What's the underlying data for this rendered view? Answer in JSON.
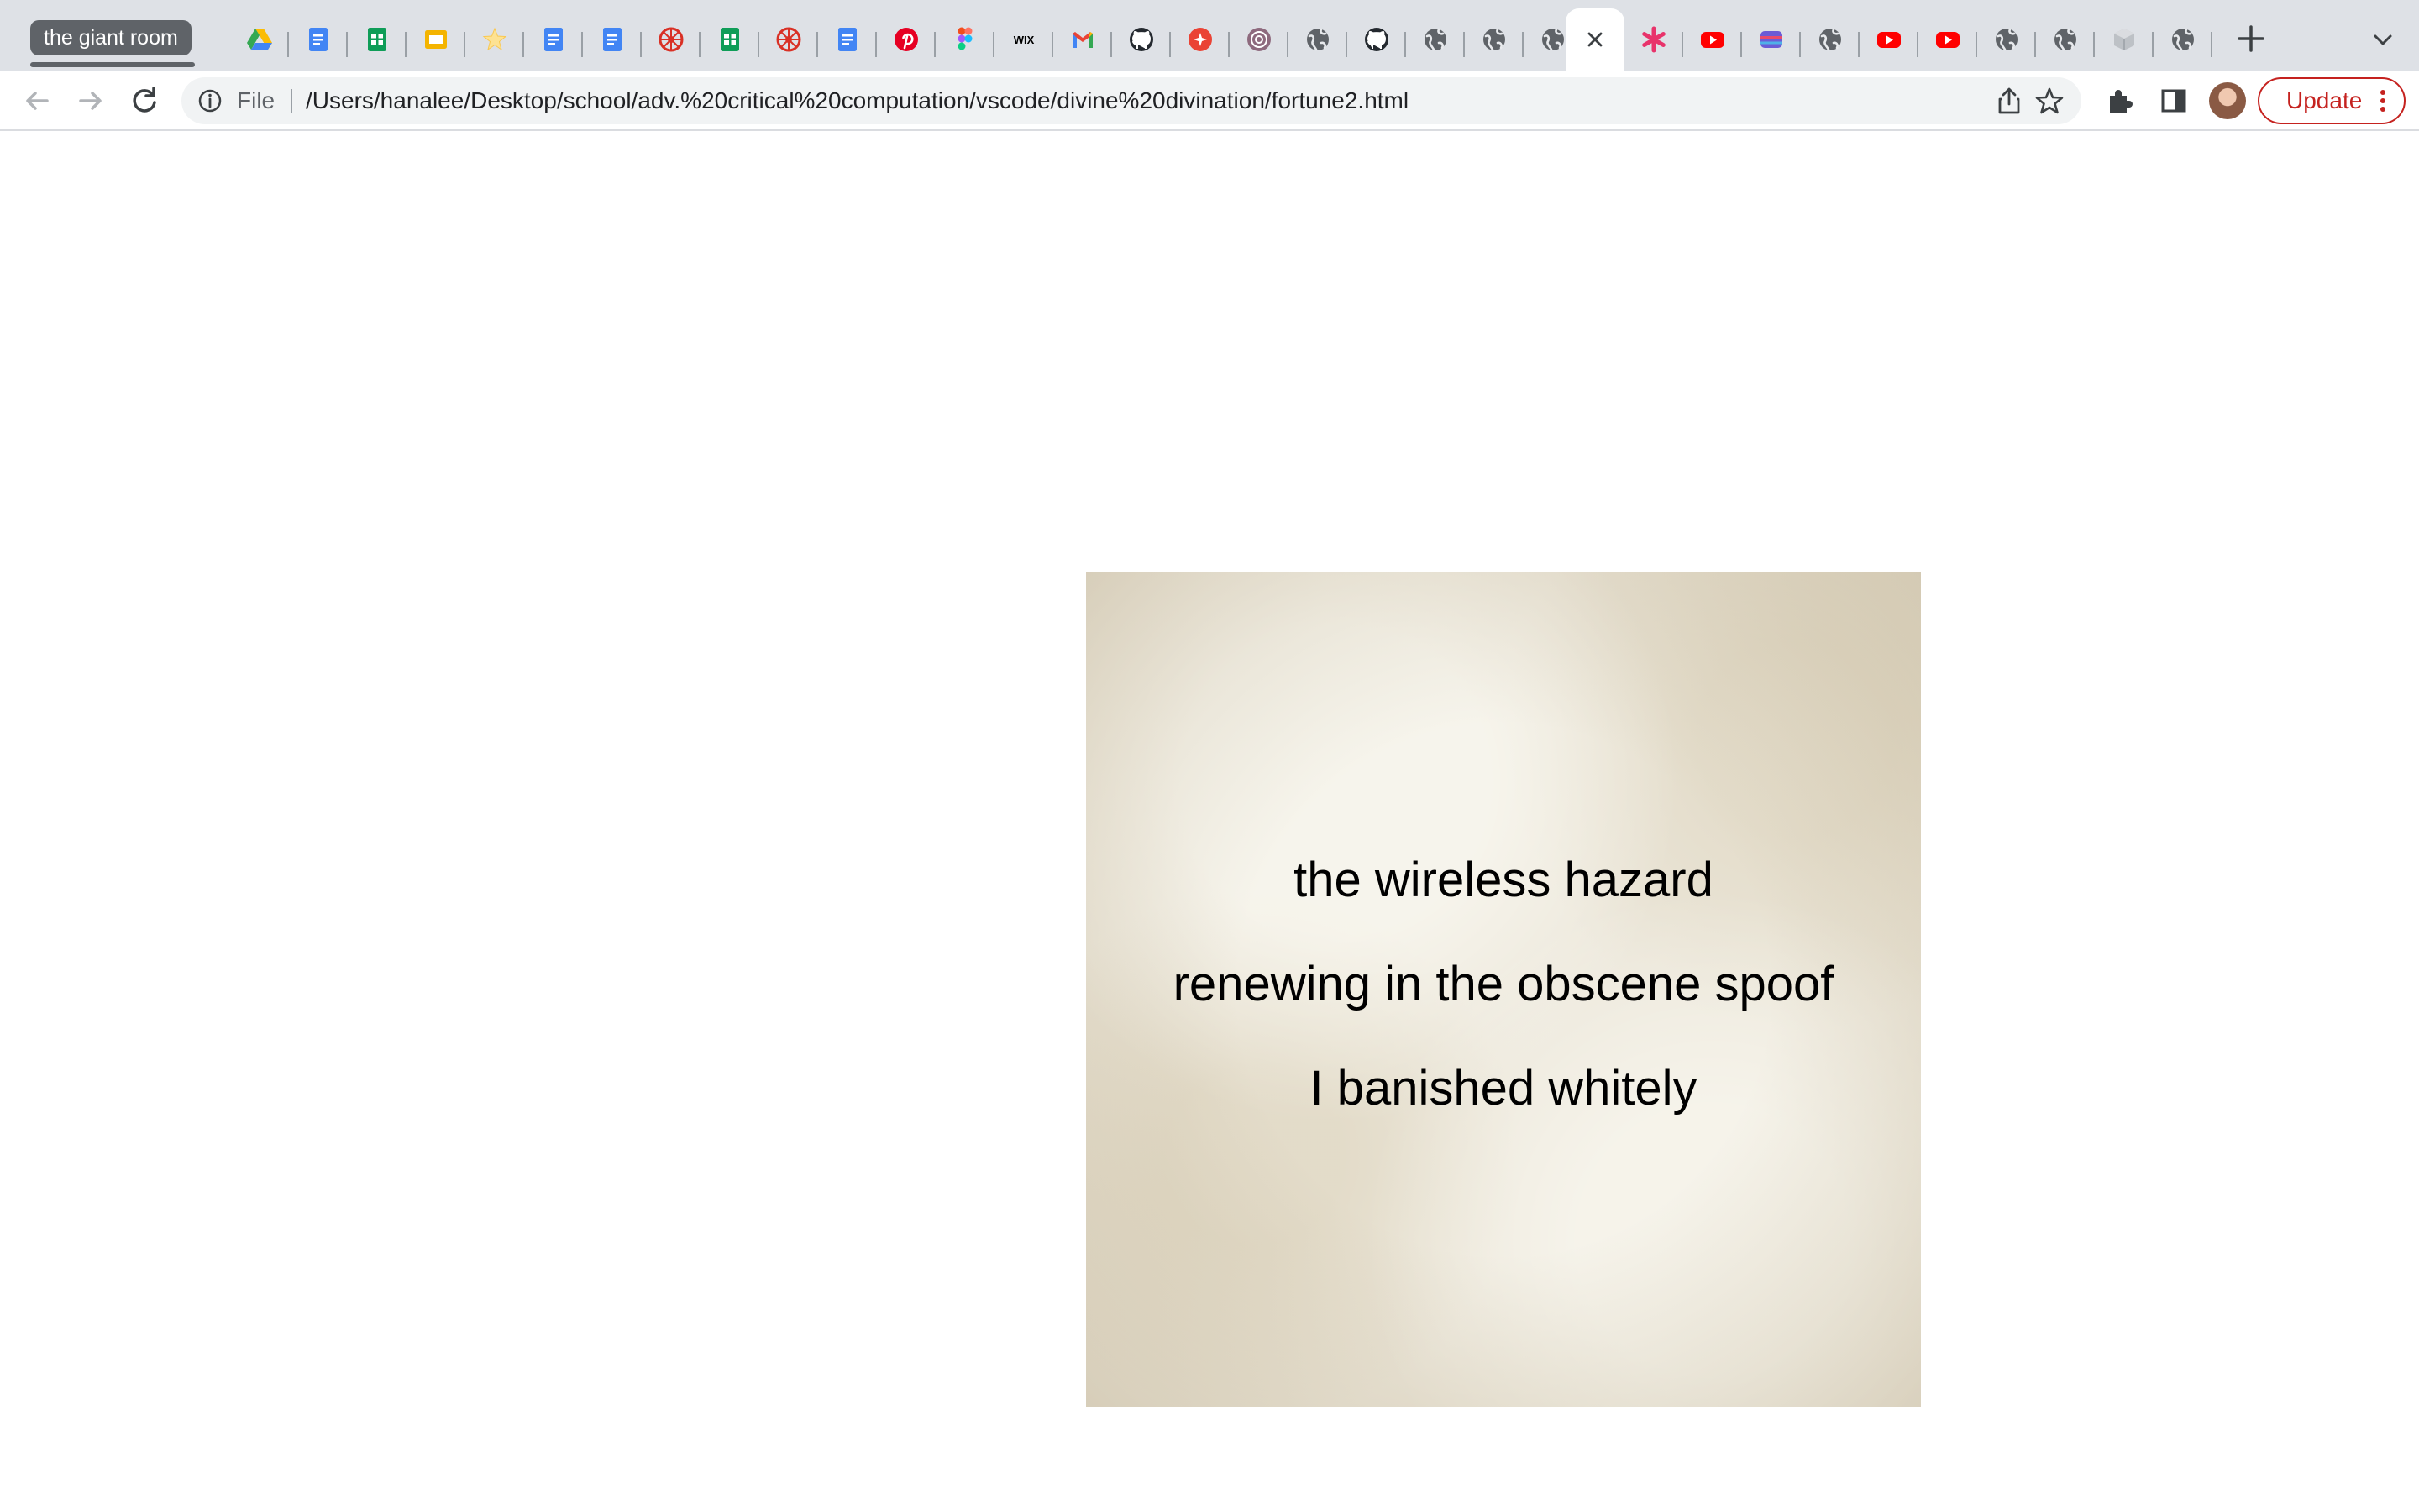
{
  "browser": {
    "tab_group_label": "the giant room",
    "tabs": [
      {
        "icon": "google-drive-icon"
      },
      {
        "icon": "google-docs-icon"
      },
      {
        "icon": "google-sheets-icon"
      },
      {
        "icon": "google-slides-icon"
      },
      {
        "icon": "star-bookmark-icon"
      },
      {
        "icon": "google-docs-icon"
      },
      {
        "icon": "google-docs-icon"
      },
      {
        "icon": "red-wheel-icon"
      },
      {
        "icon": "google-sheets-icon"
      },
      {
        "icon": "red-wheel-icon"
      },
      {
        "icon": "google-docs-icon"
      },
      {
        "icon": "pinterest-icon"
      },
      {
        "icon": "figma-icon"
      },
      {
        "icon": "wix-icon"
      },
      {
        "icon": "gmail-icon"
      },
      {
        "icon": "github-icon"
      },
      {
        "icon": "red-circle-app-icon"
      },
      {
        "icon": "swirl-app-icon"
      },
      {
        "icon": "globe-icon"
      },
      {
        "icon": "github-icon"
      },
      {
        "icon": "globe-icon"
      },
      {
        "icon": "globe-icon"
      },
      {
        "icon": "globe-icon"
      },
      {
        "icon": "close-icon",
        "active": true
      },
      {
        "icon": "asterisk-icon"
      },
      {
        "icon": "youtube-icon"
      },
      {
        "icon": "colorful-app-icon"
      },
      {
        "icon": "globe-icon"
      },
      {
        "icon": "youtube-icon"
      },
      {
        "icon": "youtube-icon"
      },
      {
        "icon": "globe-icon"
      },
      {
        "icon": "globe-icon"
      },
      {
        "icon": "cube-icon"
      },
      {
        "icon": "globe-icon"
      }
    ],
    "new_tab_icon": "plus-icon",
    "tab_search_icon": "chevron-down-icon"
  },
  "toolbar": {
    "back_icon": "back-arrow-icon",
    "forward_icon": "forward-arrow-icon",
    "reload_icon": "reload-icon",
    "site_info_icon": "info-icon",
    "scheme_label": "File",
    "url": "/Users/hanalee/Desktop/school/adv.%20critical%20computation/vscode/divine%20divination/fortune2.html",
    "share_icon": "share-icon",
    "bookmark_icon": "star-icon",
    "extensions_icon": "puzzle-icon",
    "side_panel_icon": "side-panel-icon",
    "update_label": "Update",
    "menu_icon": "kebab-menu-icon"
  },
  "fortune": {
    "lines": [
      "the wireless hazard",
      "renewing in the obscene spoof",
      "I banished whitely"
    ]
  }
}
